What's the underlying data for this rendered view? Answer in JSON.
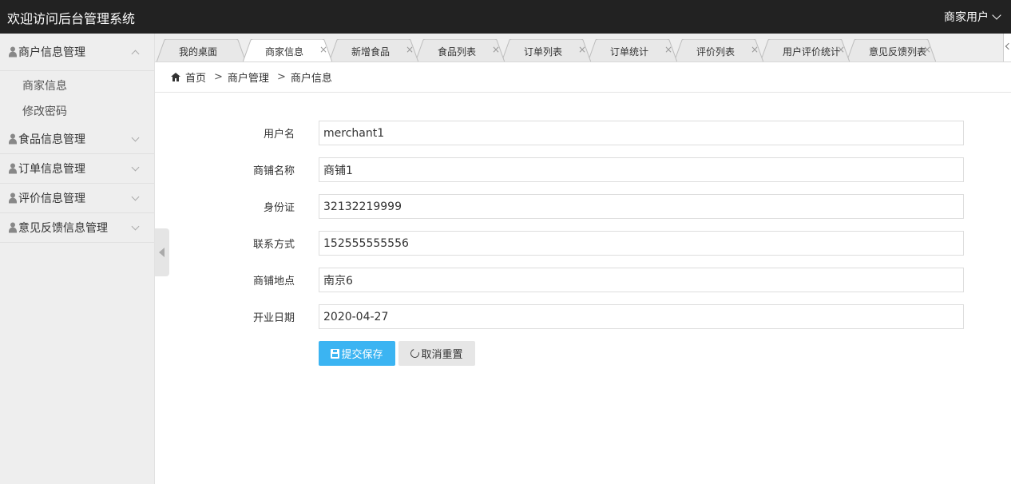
{
  "header": {
    "title": "欢迎访问后台管理系统",
    "user": "商家用户"
  },
  "sidebar": {
    "groups": [
      {
        "label": "商户信息管理",
        "expanded": true,
        "items": [
          "商家信息",
          "修改密码"
        ]
      },
      {
        "label": "食品信息管理",
        "expanded": false
      },
      {
        "label": "订单信息管理",
        "expanded": false
      },
      {
        "label": "评价信息管理",
        "expanded": false
      },
      {
        "label": "意见反馈信息管理",
        "expanded": false
      }
    ]
  },
  "tabs": [
    {
      "label": "我的桌面",
      "closable": false,
      "active": false
    },
    {
      "label": "商家信息",
      "closable": true,
      "active": true
    },
    {
      "label": "新增食品",
      "closable": true,
      "active": false
    },
    {
      "label": "食品列表",
      "closable": true,
      "active": false
    },
    {
      "label": "订单列表",
      "closable": true,
      "active": false
    },
    {
      "label": "订单统计",
      "closable": true,
      "active": false
    },
    {
      "label": "评价列表",
      "closable": true,
      "active": false
    },
    {
      "label": "用户评价统计",
      "closable": true,
      "active": false
    },
    {
      "label": "意见反馈列表",
      "closable": true,
      "active": false
    }
  ],
  "breadcrumb": {
    "home": "首页",
    "level1": "商户管理",
    "level2": "商户信息",
    "separator": ">"
  },
  "form": {
    "fields": [
      {
        "label": "用户名",
        "value": "merchant1"
      },
      {
        "label": "商铺名称",
        "value": "商铺1"
      },
      {
        "label": "身份证",
        "value": "32132219999"
      },
      {
        "label": "联系方式",
        "value": "152555555556"
      },
      {
        "label": "商铺地点",
        "value": "南京6"
      },
      {
        "label": "开业日期",
        "value": "2020-04-27"
      }
    ],
    "submit_label": "提交保存",
    "reset_label": "取消重置"
  },
  "colors": {
    "header_bg": "#222222",
    "primary": "#3bb4f2",
    "sidebar_bg": "#eeeeee"
  }
}
